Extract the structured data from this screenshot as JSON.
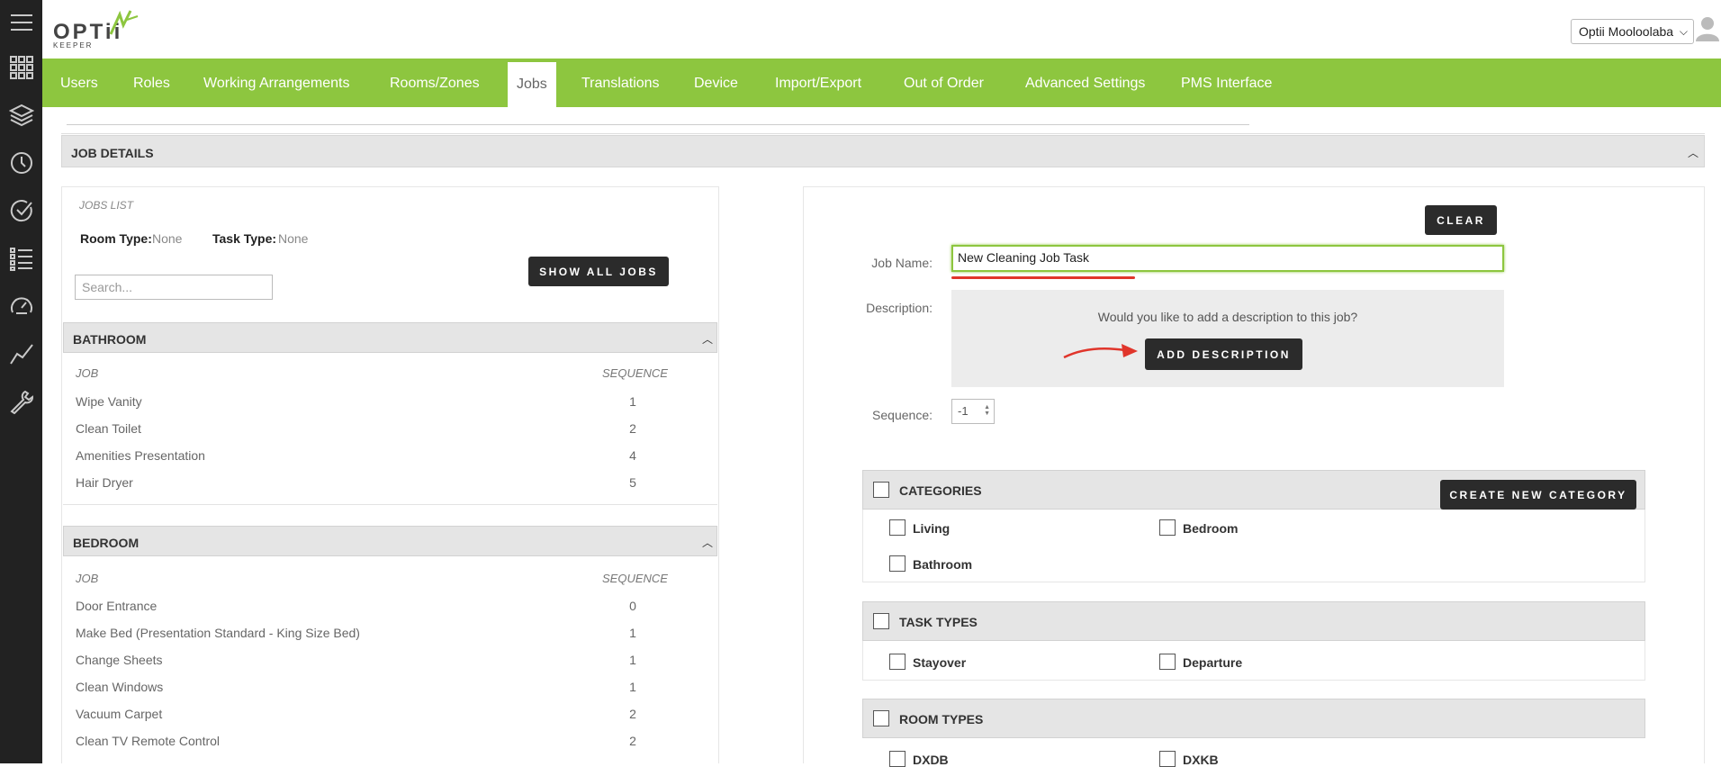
{
  "header": {
    "logo_text": "OPTii",
    "logo_subtext": "KEEPER",
    "hotel_select_value": "Optii Mooloolaba"
  },
  "sidebar": {
    "icons": [
      "menu-icon",
      "apps-grid-icon",
      "layers-icon",
      "clock-icon",
      "check-circle-icon",
      "list-icon",
      "dashboard-icon",
      "chart-icon",
      "wrench-icon"
    ]
  },
  "nav": {
    "tabs": [
      {
        "label": "Users"
      },
      {
        "label": "Roles"
      },
      {
        "label": "Working Arrangements"
      },
      {
        "label": "Rooms/Zones"
      },
      {
        "label": "Jobs",
        "active": true
      },
      {
        "label": "Translations"
      },
      {
        "label": "Device"
      },
      {
        "label": "Import/Export"
      },
      {
        "label": "Out of Order"
      },
      {
        "label": "Advanced Settings"
      },
      {
        "label": "PMS Interface"
      }
    ]
  },
  "job_details": {
    "section_title": "JOB DETAILS",
    "jobs_list": {
      "label": "JOBS LIST",
      "room_type_label": "Room Type:",
      "room_type_value": "None",
      "task_type_label": "Task Type:",
      "task_type_value": "None",
      "search_placeholder": "Search...",
      "show_all_label": "SHOW ALL JOBS",
      "job_col": "JOB",
      "seq_col": "SEQUENCE",
      "groups": [
        {
          "name": "BATHROOM",
          "jobs": [
            {
              "name": "Wipe Vanity",
              "seq": "1"
            },
            {
              "name": "Clean Toilet",
              "seq": "2"
            },
            {
              "name": "Amenities Presentation",
              "seq": "4"
            },
            {
              "name": "Hair Dryer",
              "seq": "5"
            }
          ]
        },
        {
          "name": "BEDROOM",
          "jobs": [
            {
              "name": "Door Entrance",
              "seq": "0"
            },
            {
              "name": "Make Bed (Presentation Standard - King Size Bed)",
              "seq": "1"
            },
            {
              "name": "Change Sheets",
              "seq": "1"
            },
            {
              "name": "Clean Windows",
              "seq": "1"
            },
            {
              "name": "Vacuum Carpet",
              "seq": "2"
            },
            {
              "name": "Clean TV Remote Control",
              "seq": "2"
            }
          ]
        }
      ]
    },
    "form": {
      "clear_label": "CLEAR",
      "job_name_label": "Job Name:",
      "job_name_value": "New Cleaning Job Task",
      "description_label": "Description:",
      "description_prompt": "Would you like to add a description to this job?",
      "add_description_label": "ADD DESCRIPTION",
      "sequence_label": "Sequence:",
      "sequence_value": "-1"
    },
    "categories": {
      "title": "CATEGORIES",
      "create_label": "CREATE NEW CATEGORY",
      "items": [
        "Living",
        "Bedroom",
        "Bathroom"
      ]
    },
    "task_types": {
      "title": "TASK TYPES",
      "items": [
        "Stayover",
        "Departure"
      ]
    },
    "room_types": {
      "title": "ROOM TYPES",
      "items": [
        "DXDB",
        "DXKB"
      ]
    }
  },
  "colors": {
    "nav_green": "#8dc63f",
    "sidebar_dark": "#222222",
    "button_dark": "#2b2b2b",
    "annotation_red": "#e0352b"
  }
}
